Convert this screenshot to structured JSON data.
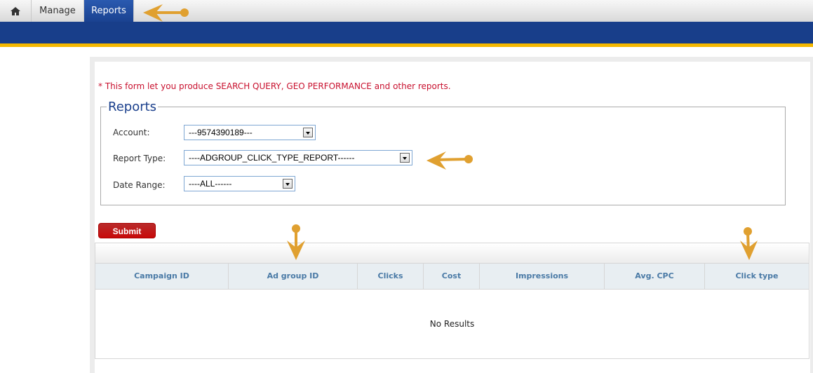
{
  "nav": {
    "tabs": [
      {
        "label": "Manage"
      },
      {
        "label": "Reports"
      }
    ]
  },
  "form": {
    "note": "* This form let you produce SEARCH QUERY, GEO PERFORMANCE and other reports.",
    "legend": "Reports",
    "account": {
      "label": "Account:",
      "value": "---9574390189---"
    },
    "report_type": {
      "label": "Report Type:",
      "value": "----ADGROUP_CLICK_TYPE_REPORT------"
    },
    "date_range": {
      "label": "Date Range:",
      "value": "----ALL------"
    },
    "submit": "Submit"
  },
  "table": {
    "columns": [
      "Campaign ID",
      "Ad group ID",
      "Clicks",
      "Cost",
      "Impressions",
      "Avg. CPC",
      "Click type"
    ],
    "empty": "No Results"
  },
  "colors": {
    "accent": "#183e8a",
    "stripe": "#f5b800",
    "arrow": "#e0a030"
  }
}
